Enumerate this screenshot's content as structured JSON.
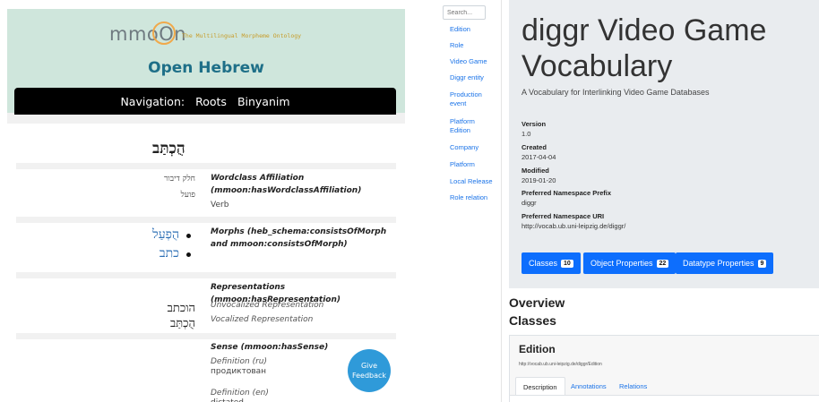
{
  "left": {
    "logo_text": "mmoOn",
    "tagline": "The Multilingual Morpheme Ontology",
    "site_title": "Open Hebrew",
    "nav": {
      "prefix": "Navigation:",
      "items": [
        "Roots",
        "Binyanim"
      ]
    },
    "word": "הֻכְתַּב",
    "wordclass": {
      "heb_label": "חלק דיבור",
      "heb_value": "פועל",
      "label": "Wordclass Affiliation (mmoon:hasWordclassAffiliation)",
      "value": "Verb"
    },
    "morphs": {
      "label": "Morphs (heb_schema:consistsOfMorph and mmoon:consistsOfMorph)",
      "items": [
        "הֻפְעַל",
        "כתב"
      ]
    },
    "representations": {
      "label": "Representations (mmoon:hasRepresentation)",
      "items": [
        {
          "heb": "הוכתב",
          "label": "Unvocalized Representation"
        },
        {
          "heb": "הֻכְתַּב",
          "label": "Vocalized Representation"
        }
      ]
    },
    "sense": {
      "label": "Sense (mmoon:hasSense)",
      "def_ru_label": "Definition (ru)",
      "def_ru": "продиктован",
      "def_en_label": "Definition (en)",
      "def_en": "dictated"
    },
    "feedback_button": "Give Feedback"
  },
  "right": {
    "search_placeholder": "Search...",
    "sidebar_items": [
      "Edition",
      "Role",
      "Video Game",
      "Diggr entity",
      "Production event",
      "Platform Edition",
      "Company",
      "Platform",
      "Local Release",
      "Role relation"
    ],
    "title": "diggr Video Game Vocabulary",
    "subtitle": "A Vocabulary for Interlinking Video Game Databases",
    "meta": [
      {
        "key": "Version",
        "value": "1.0"
      },
      {
        "key": "Created",
        "value": "2017-04-04"
      },
      {
        "key": "Modified",
        "value": "2019-01-20"
      },
      {
        "key": "Preferred Namespace Prefix",
        "value": "diggr"
      },
      {
        "key": "Preferred Namespace URI",
        "value": "http://vocab.ub.uni-leipzig.de/diggr/"
      }
    ],
    "buttons": [
      {
        "label": "Classes",
        "count": "10"
      },
      {
        "label": "Object Properties",
        "count": "22"
      },
      {
        "label": "Datatype Properties",
        "count": "9"
      }
    ],
    "overview_heading": "Overview",
    "classes_heading": "Classes",
    "card": {
      "title": "Edition",
      "uri": "http://vocab.ub.uni-leipzig.de/diggr/Edition",
      "tabs": [
        "Description",
        "Annotations",
        "Relations"
      ]
    },
    "colors": {
      "primary": "#0d6efd",
      "jumbotron": "#e9ecef",
      "header_green": "#cfe6dc",
      "title_blue": "#1e6f88",
      "feedback": "#2f9ad9"
    }
  }
}
